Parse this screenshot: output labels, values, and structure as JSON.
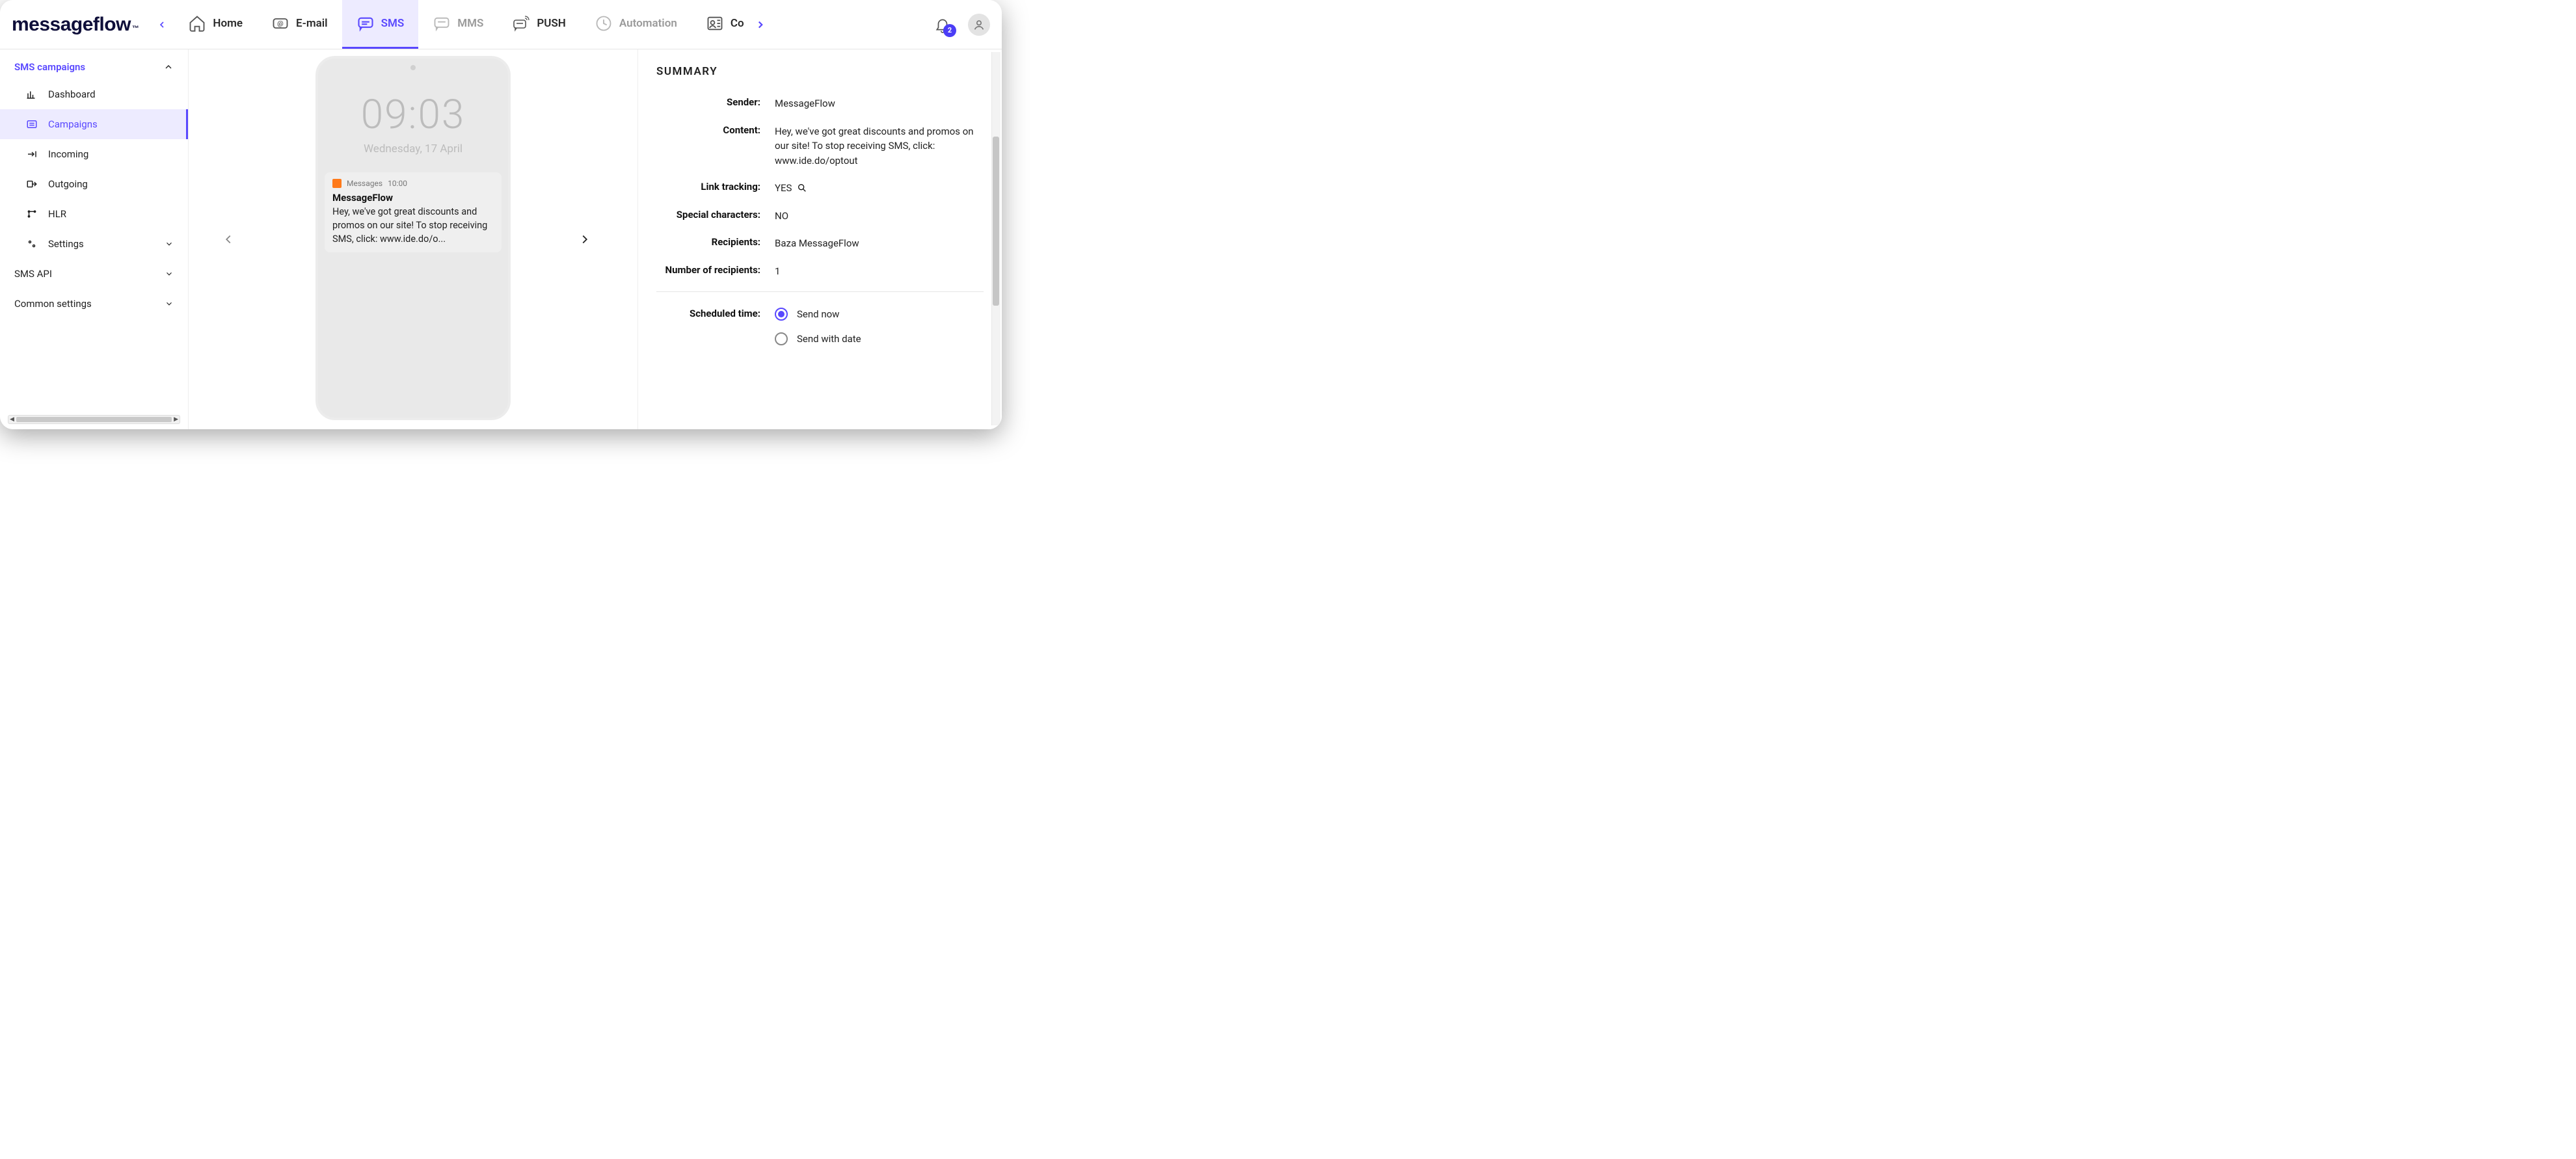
{
  "brand": {
    "name": "messageflow",
    "tm": "™"
  },
  "nav": {
    "home": "Home",
    "email": "E-mail",
    "sms": "SMS",
    "mms": "MMS",
    "push": "PUSH",
    "automation": "Automation",
    "contacts": "Co"
  },
  "notifications": {
    "count": "2"
  },
  "sidebar": {
    "section": "SMS campaigns",
    "items": {
      "dashboard": "Dashboard",
      "campaigns": "Campaigns",
      "incoming": "Incoming",
      "outgoing": "Outgoing",
      "hlr": "HLR",
      "settings": "Settings"
    },
    "sms_api": "SMS API",
    "common_settings": "Common settings"
  },
  "preview": {
    "clock": "09:03",
    "date": "Wednesday, 17 April",
    "notif_app": "Messages",
    "notif_time": "10:00",
    "notif_sender": "MessageFlow",
    "notif_body": "Hey, we've got great discounts and promos on our site! To stop receiving SMS, click: www.ide.do/o..."
  },
  "summary": {
    "title": "SUMMARY",
    "labels": {
      "sender": "Sender:",
      "content": "Content:",
      "link_tracking": "Link tracking:",
      "special_chars": "Special characters:",
      "recipients": "Recipients:",
      "num_recipients": "Number of recipients:",
      "scheduled": "Scheduled time:"
    },
    "values": {
      "sender": "MessageFlow",
      "content": "Hey, we've got great discounts and promos on our site! To stop receiving SMS, click: www.ide.do/optout",
      "link_tracking": "YES",
      "special_chars": "NO",
      "recipients": "Baza MessageFlow",
      "num_recipients": "1"
    },
    "schedule_options": {
      "now": "Send now",
      "date": "Send with date"
    }
  }
}
